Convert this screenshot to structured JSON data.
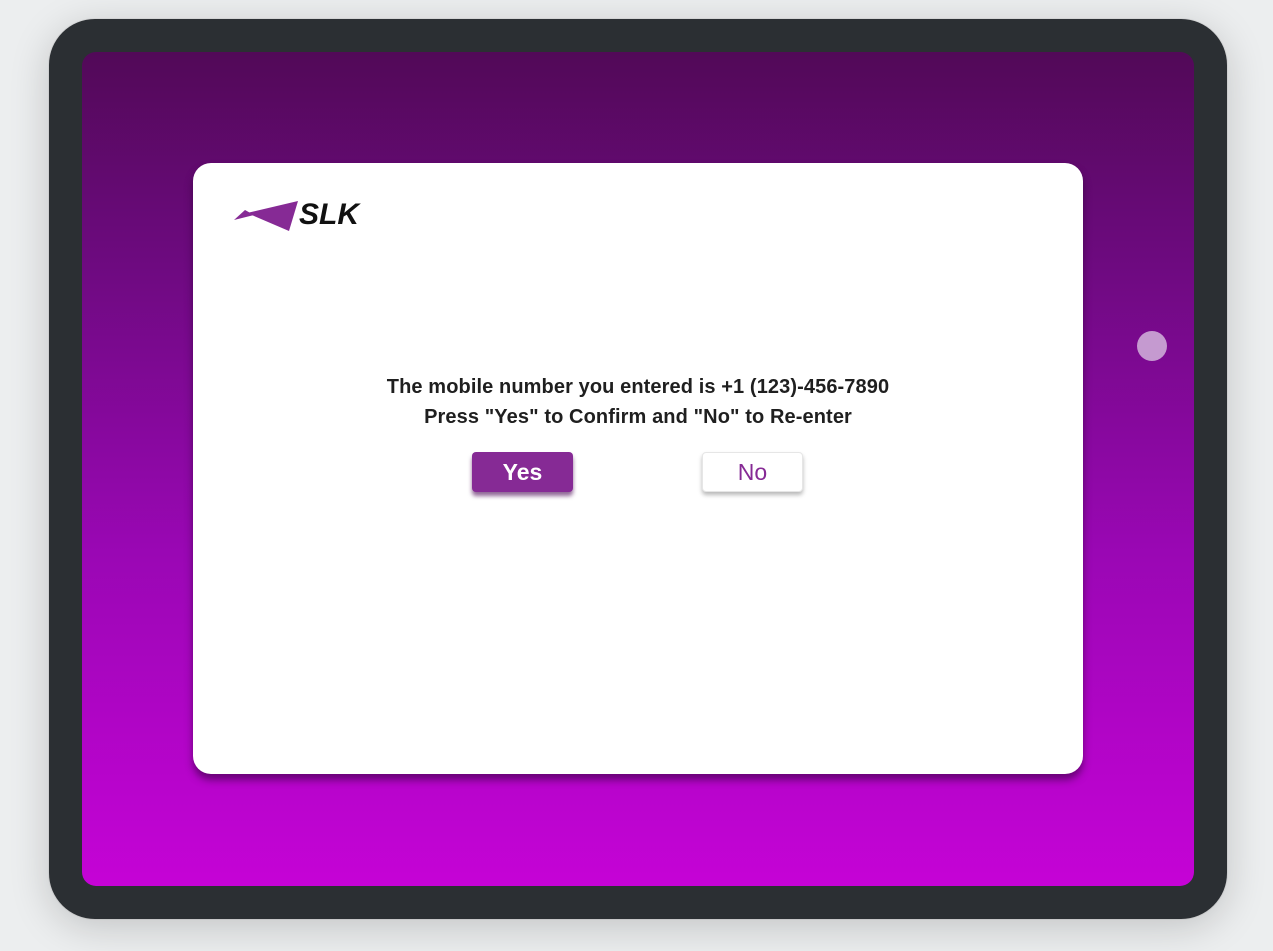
{
  "brand": {
    "name": "SLK",
    "accent_color": "#862a95"
  },
  "dialog": {
    "message_line1": "The mobile number you entered is +1 (123)-456-7890",
    "message_line2": "Press \"Yes\" to Confirm and \"No\" to Re-enter",
    "yes_label": "Yes",
    "no_label": "No"
  },
  "device": {
    "home_button_icon": "circle-icon"
  }
}
